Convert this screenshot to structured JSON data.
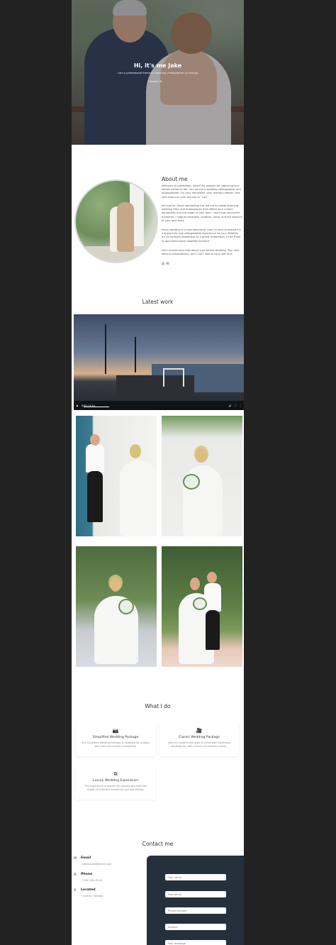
{
  "hero": {
    "title": "Hi, it's me Jake",
    "subtitle": "I am a professional freelance wedding videographer in Georgia",
    "contact_link": "Contact ✉"
  },
  "about": {
    "title": "About me",
    "paragraphs": [
      "Welcome to JakesVideo, where my passion for capturing love stories comes to life. I'm not just a wedding videographer and photographer; I'm your storyteller, your memory keeper, and your friend on your journey to \"I do.\"",
      "My love for visual storytelling has led me to create stunning wedding films and photographs that reflect your unique personality and the magic of your love. I don't just document moments; I capture emotions, laughter, tears, and the essence of your love story.",
      "Every wedding is a new adventure, and I'm here to ensure it's a stress-free and unforgettable experience for you. Whether it's an intimate elopement or a grand celebration, I'll be there to document every heartfelt moment.",
      "Let's connect and chat about your dream wedding. Your love story is extraordinary, and I can't wait to be a part of it!"
    ],
    "social_icons": [
      "instagram-icon",
      "email-icon"
    ]
  },
  "latest_work": {
    "title": "Latest work",
    "video_time": "0:00 / 0:14"
  },
  "services": {
    "title": "What I do",
    "items": [
      {
        "icon": "camera-icon",
        "title": "Simplified Wedding Package",
        "desc": "The Simplified Wedding package is designed for couples who value the beauty of simplicity."
      },
      {
        "icon": "video-camera-icon",
        "title": "Classic Wedding Package",
        "desc": "Ideal for couples who want to relive their traditional wedding day with a touch of cinematic charm."
      },
      {
        "icon": "sitemap-icon",
        "title": "Luxury Wedding Experience",
        "desc": "This experience is tailored for couples who seek the height of cinematic excellence and storytelling."
      }
    ]
  },
  "contact": {
    "title": "Contact me",
    "info": [
      {
        "icon": "envelope-icon",
        "label": "Email",
        "value": "jakesvideo@gmail.com"
      },
      {
        "icon": "phone-icon",
        "label": "Phone",
        "value": "(740) 424-9940"
      },
      {
        "icon": "location-pin-icon",
        "label": "Located",
        "value": "Central, Georgia"
      }
    ],
    "form": {
      "name_placeholder": "Your name",
      "email_placeholder": "Your email",
      "phone_placeholder": "Phone Number",
      "subject_placeholder": "Subject",
      "message_placeholder": "Your message"
    }
  },
  "colors": {
    "page_bg": "#222222",
    "form_bg": "#25303d"
  }
}
